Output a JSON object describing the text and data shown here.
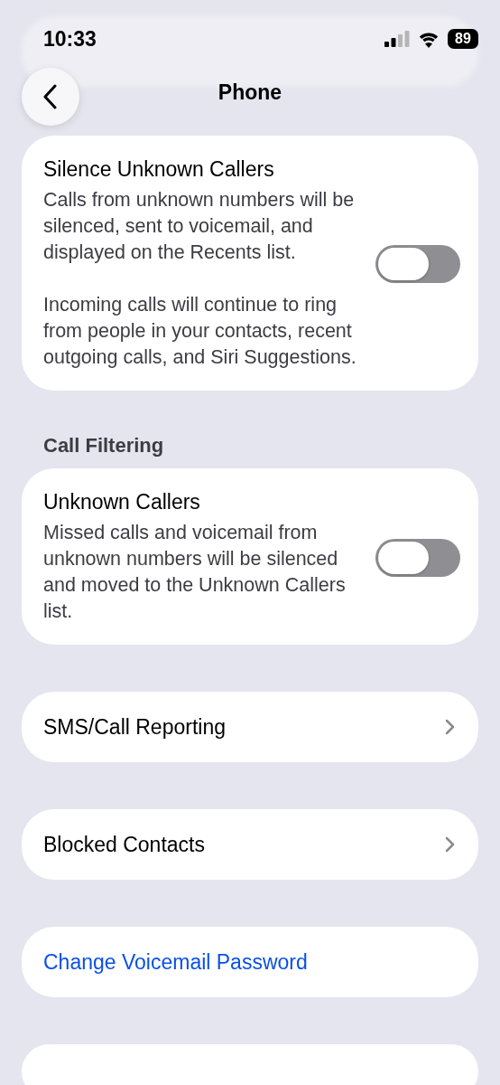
{
  "status_bar": {
    "time": "10:33",
    "battery": "89"
  },
  "nav": {
    "title": "Phone"
  },
  "sections": [
    {
      "rows": [
        {
          "kind": "toggle",
          "title": "Silence Unknown Callers",
          "description": [
            "Calls from unknown numbers will be silenced, sent to voicemail, and displayed on the Recents list.",
            "Incoming calls will continue to ring from people in your contacts, recent outgoing calls, and Siri Suggestions."
          ],
          "on": false
        }
      ]
    },
    {
      "heading": "Call Filtering",
      "rows": [
        {
          "kind": "toggle",
          "title": "Unknown Callers",
          "description": [
            "Missed calls and voicemail from unknown numbers will be silenced and moved to the Unknown Callers list."
          ],
          "on": false
        }
      ]
    },
    {
      "rows": [
        {
          "kind": "nav",
          "title": "SMS/Call Reporting"
        }
      ]
    },
    {
      "rows": [
        {
          "kind": "nav",
          "title": "Blocked Contacts"
        }
      ]
    },
    {
      "rows": [
        {
          "kind": "link",
          "title": "Change Voicemail Password"
        }
      ]
    },
    {
      "rows": [
        {
          "kind": "empty"
        }
      ]
    }
  ]
}
